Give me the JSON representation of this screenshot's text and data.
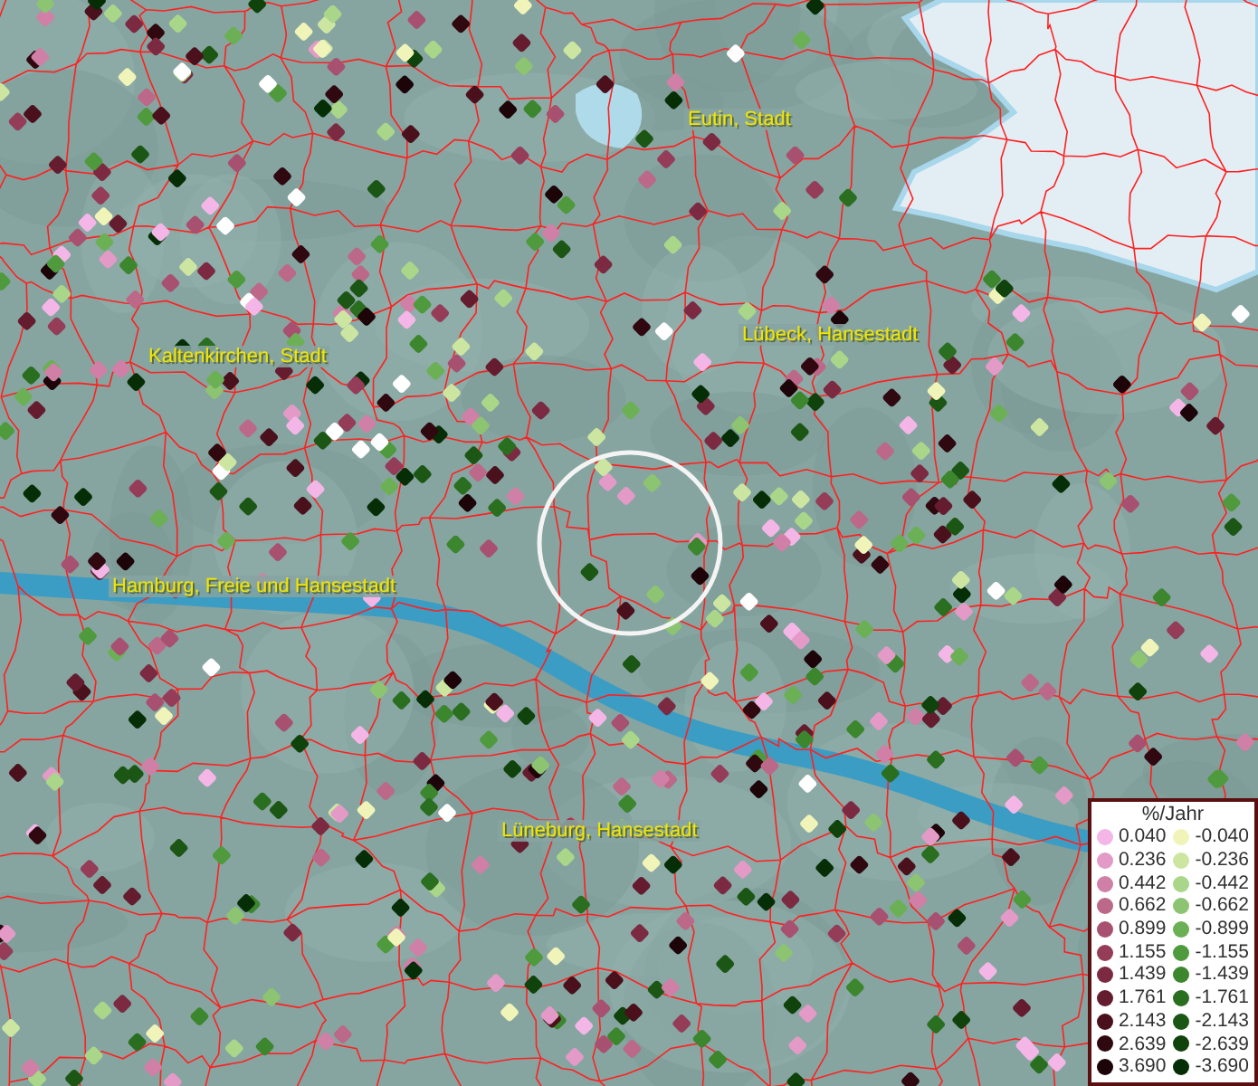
{
  "map": {
    "places": [
      {
        "name": "Eutin, Stadt"
      },
      {
        "name": "Lübeck, Hansestadt"
      },
      {
        "name": "Kaltenkirchen, Stadt"
      },
      {
        "name": "Hamburg, Freie und Hansestadt"
      },
      {
        "name": "Lüneburg, Hansestadt"
      }
    ]
  },
  "legend": {
    "title": "%/Jahr",
    "positive": [
      {
        "label": "0.040",
        "color": "#f4b6e6"
      },
      {
        "label": "0.236",
        "color": "#e49ac6"
      },
      {
        "label": "0.442",
        "color": "#d080a6"
      },
      {
        "label": "0.662",
        "color": "#bc6888"
      },
      {
        "label": "0.899",
        "color": "#a85070"
      },
      {
        "label": "1.155",
        "color": "#943c58"
      },
      {
        "label": "1.439",
        "color": "#7c2a42"
      },
      {
        "label": "1.761",
        "color": "#641c2e"
      },
      {
        "label": "2.143",
        "color": "#4a101c"
      },
      {
        "label": "2.639",
        "color": "#300810"
      },
      {
        "label": "3.690",
        "color": "#1c0408"
      }
    ],
    "negative": [
      {
        "label": "-0.040",
        "color": "#f0f4b8"
      },
      {
        "label": "-0.236",
        "color": "#cce6a2"
      },
      {
        "label": "-0.442",
        "color": "#aad68a"
      },
      {
        "label": "-0.662",
        "color": "#8cc472"
      },
      {
        "label": "-0.899",
        "color": "#6cb056"
      },
      {
        "label": "-1.155",
        "color": "#4e9a3c"
      },
      {
        "label": "-1.439",
        "color": "#3c862e"
      },
      {
        "label": "-1.761",
        "color": "#2a6e20"
      },
      {
        "label": "-2.143",
        "color": "#1c5614"
      },
      {
        "label": "-2.639",
        "color": "#10420c"
      },
      {
        "label": "-3.690",
        "color": "#062e06"
      }
    ]
  }
}
